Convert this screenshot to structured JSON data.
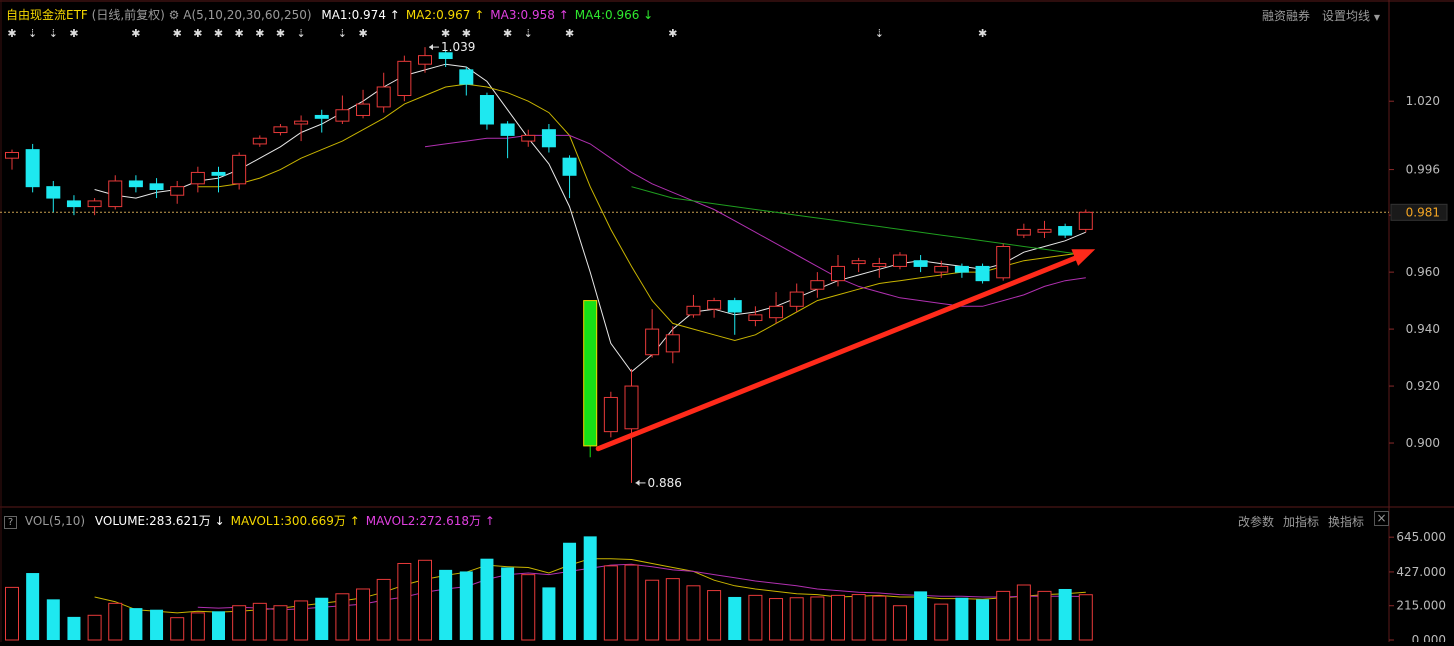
{
  "header": {
    "title": "自由现金流ETF",
    "period": "(日线,前复权)",
    "ma_params": "A(5,10,20,30,60,250)",
    "ma_values": [
      {
        "label": "MA1:0.974",
        "arrow": "↑",
        "color": "#ffffff"
      },
      {
        "label": "MA2:0.967",
        "arrow": "↑",
        "color": "#f5d800"
      },
      {
        "label": "MA3:0.958",
        "arrow": "↑",
        "color": "#e040e0"
      },
      {
        "label": "MA4:0.966",
        "arrow": "↓",
        "color": "#2ee82e"
      }
    ],
    "right_buttons": [
      "融资融券",
      "设置均线"
    ]
  },
  "volume_header": {
    "help": "?",
    "label": "VOL(5,10)",
    "items": [
      {
        "label": "VOLUME:283.621万",
        "arrow": "↓",
        "color": "#ffffff"
      },
      {
        "label": "MAVOL1:300.669万",
        "arrow": "↑",
        "color": "#f5d800"
      },
      {
        "label": "MAVOL2:272.618万",
        "arrow": "↑",
        "color": "#e040e0"
      }
    ],
    "right_buttons": [
      "改参数",
      "加指标",
      "换指标"
    ],
    "close": "×"
  },
  "chart_data": {
    "type": "candlestick",
    "price_axis": {
      "ticks": [
        "1.020",
        "0.996",
        "0.980",
        "0.960",
        "0.940",
        "0.920",
        "0.900"
      ],
      "tick_values": [
        1.02,
        0.996,
        0.98,
        0.96,
        0.94,
        0.92,
        0.9
      ],
      "ylim": [
        0.88,
        1.045
      ]
    },
    "current_price": {
      "label": "0.981",
      "value": 0.981
    },
    "annotations": [
      {
        "label": "1.039",
        "value": 1.039,
        "type": "high"
      },
      {
        "label": "0.886",
        "value": 0.886,
        "type": "low"
      }
    ],
    "candles": [
      [
        1.0,
        1.002,
        1.003,
        0.996
      ],
      [
        1.003,
        0.99,
        1.005,
        0.988
      ],
      [
        0.99,
        0.986,
        0.992,
        0.981
      ],
      [
        0.985,
        0.983,
        0.987,
        0.98
      ],
      [
        0.983,
        0.985,
        0.986,
        0.98
      ],
      [
        0.983,
        0.992,
        0.994,
        0.982
      ],
      [
        0.992,
        0.99,
        0.994,
        0.988
      ],
      [
        0.991,
        0.989,
        0.993,
        0.986
      ],
      [
        0.987,
        0.99,
        0.992,
        0.984
      ],
      [
        0.991,
        0.995,
        0.997,
        0.988
      ],
      [
        0.995,
        0.994,
        0.997,
        0.988
      ],
      [
        0.991,
        1.001,
        1.002,
        0.989
      ],
      [
        1.005,
        1.007,
        1.008,
        1.004
      ],
      [
        1.009,
        1.011,
        1.012,
        1.008
      ],
      [
        1.012,
        1.013,
        1.015,
        1.006
      ],
      [
        1.015,
        1.014,
        1.017,
        1.009
      ],
      [
        1.013,
        1.017,
        1.022,
        1.012
      ],
      [
        1.015,
        1.019,
        1.024,
        1.014
      ],
      [
        1.018,
        1.025,
        1.03,
        1.016
      ],
      [
        1.022,
        1.034,
        1.036,
        1.02
      ],
      [
        1.033,
        1.036,
        1.039,
        1.03
      ],
      [
        1.037,
        1.035,
        1.038,
        1.032
      ],
      [
        1.031,
        1.026,
        1.032,
        1.022
      ],
      [
        1.022,
        1.012,
        1.023,
        1.01
      ],
      [
        1.012,
        1.008,
        1.013,
        1.0
      ],
      [
        1.006,
        1.008,
        1.01,
        1.004
      ],
      [
        1.01,
        1.004,
        1.012,
        1.002
      ],
      [
        1.0,
        0.994,
        1.001,
        0.986
      ],
      [
        0.95,
        0.899,
        0.95,
        0.895
      ],
      [
        0.904,
        0.916,
        0.918,
        0.902
      ],
      [
        0.905,
        0.92,
        0.926,
        0.886
      ],
      [
        0.931,
        0.94,
        0.947,
        0.93
      ],
      [
        0.932,
        0.938,
        0.941,
        0.928
      ],
      [
        0.945,
        0.948,
        0.952,
        0.944
      ],
      [
        0.947,
        0.95,
        0.951,
        0.944
      ],
      [
        0.95,
        0.946,
        0.951,
        0.938
      ],
      [
        0.943,
        0.945,
        0.948,
        0.941
      ],
      [
        0.944,
        0.948,
        0.953,
        0.942
      ],
      [
        0.948,
        0.953,
        0.956,
        0.946
      ],
      [
        0.954,
        0.957,
        0.96,
        0.951
      ],
      [
        0.957,
        0.962,
        0.966,
        0.955
      ],
      [
        0.963,
        0.964,
        0.965,
        0.96
      ],
      [
        0.962,
        0.963,
        0.965,
        0.958
      ],
      [
        0.962,
        0.966,
        0.967,
        0.961
      ],
      [
        0.964,
        0.962,
        0.966,
        0.96
      ],
      [
        0.96,
        0.962,
        0.964,
        0.958
      ],
      [
        0.962,
        0.96,
        0.963,
        0.958
      ],
      [
        0.962,
        0.957,
        0.963,
        0.956
      ],
      [
        0.958,
        0.969,
        0.97,
        0.957
      ],
      [
        0.973,
        0.975,
        0.977,
        0.972
      ],
      [
        0.974,
        0.975,
        0.978,
        0.972
      ],
      [
        0.976,
        0.973,
        0.977,
        0.972
      ],
      [
        0.975,
        0.981,
        0.982,
        0.974
      ]
    ],
    "series": [
      {
        "values": [
          null,
          null,
          null,
          null,
          0.989,
          0.987,
          0.986,
          0.988,
          0.989,
          0.992,
          0.993,
          0.996,
          1.0,
          1.004,
          1.009,
          1.012,
          1.016,
          1.02,
          1.025,
          1.029,
          1.031,
          1.033,
          1.032,
          1.027,
          1.017,
          1.007,
          0.998,
          0.983,
          0.96,
          0.935,
          0.925,
          0.931,
          0.94,
          0.946,
          0.947,
          0.945,
          0.946,
          0.948,
          0.951,
          0.954,
          0.957,
          0.959,
          0.961,
          0.963,
          0.964,
          0.963,
          0.962,
          0.961,
          0.963,
          0.967,
          0.969,
          0.971,
          0.974
        ]
      },
      {
        "values": [
          null,
          null,
          null,
          null,
          null,
          null,
          null,
          null,
          null,
          0.99,
          0.99,
          0.991,
          0.993,
          0.996,
          1.0,
          1.003,
          1.006,
          1.01,
          1.014,
          1.019,
          1.022,
          1.025,
          1.026,
          1.025,
          1.023,
          1.02,
          1.016,
          1.008,
          0.99,
          0.975,
          0.962,
          0.95,
          0.942,
          0.94,
          0.938,
          0.936,
          0.938,
          0.942,
          0.946,
          0.95,
          0.952,
          0.954,
          0.956,
          0.957,
          0.958,
          0.959,
          0.96,
          0.96,
          0.962,
          0.964,
          0.965,
          0.966,
          0.967
        ]
      },
      {
        "values": [
          null,
          null,
          null,
          null,
          null,
          null,
          null,
          null,
          null,
          null,
          null,
          null,
          null,
          null,
          null,
          null,
          null,
          null,
          null,
          null,
          1.004,
          1.005,
          1.006,
          1.007,
          1.007,
          1.008,
          1.008,
          1.008,
          1.005,
          1.0,
          0.995,
          0.991,
          0.988,
          0.985,
          0.982,
          0.978,
          0.974,
          0.97,
          0.966,
          0.962,
          0.958,
          0.955,
          0.953,
          0.951,
          0.95,
          0.949,
          0.948,
          0.948,
          0.95,
          0.952,
          0.955,
          0.957,
          0.958
        ]
      },
      {
        "values": [
          null,
          null,
          null,
          null,
          null,
          null,
          null,
          null,
          null,
          null,
          null,
          null,
          null,
          null,
          null,
          null,
          null,
          null,
          null,
          null,
          null,
          null,
          null,
          null,
          null,
          null,
          null,
          null,
          null,
          null,
          0.99,
          0.988,
          0.986,
          0.985,
          0.984,
          0.983,
          0.982,
          0.981,
          0.98,
          0.979,
          0.978,
          0.977,
          0.976,
          0.975,
          0.974,
          0.973,
          0.972,
          0.971,
          0.97,
          0.969,
          0.968,
          0.967,
          0.966
        ]
      }
    ],
    "marker_columns": [
      0,
      1,
      2,
      3,
      6,
      8,
      9,
      10,
      11,
      12,
      13,
      14,
      16,
      17,
      21,
      22,
      24,
      25,
      27,
      32,
      42,
      47
    ],
    "marker_arrow_columns": [
      1,
      2,
      14,
      16,
      25,
      42
    ],
    "volume_axis": {
      "ticks": [
        "645.000",
        "427.000",
        "215.000",
        "0.000"
      ],
      "tick_values": [
        645,
        427,
        215,
        0
      ],
      "ylim": [
        0,
        690
      ]
    },
    "volume": [
      330,
      420,
      255,
      145,
      155,
      230,
      200,
      190,
      140,
      170,
      180,
      215,
      230,
      215,
      245,
      265,
      290,
      320,
      380,
      480,
      500,
      440,
      430,
      510,
      455,
      410,
      330,
      610,
      650,
      465,
      470,
      375,
      385,
      340,
      310,
      270,
      280,
      260,
      265,
      270,
      280,
      285,
      275,
      215,
      305,
      225,
      265,
      255,
      305,
      345,
      305,
      320,
      284
    ],
    "volume_series": [
      {
        "values": [
          null,
          null,
          null,
          null,
          270,
          240,
          190,
          180,
          170,
          180,
          175,
          180,
          190,
          200,
          215,
          230,
          245,
          265,
          300,
          345,
          380,
          405,
          425,
          470,
          460,
          455,
          420,
          470,
          510,
          510,
          505,
          480,
          455,
          430,
          375,
          340,
          320,
          305,
          290,
          285,
          270,
          275,
          280,
          270,
          270,
          260,
          260,
          255,
          265,
          275,
          285,
          290,
          300
        ]
      },
      {
        "values": [
          null,
          null,
          null,
          null,
          null,
          null,
          null,
          null,
          null,
          205,
          200,
          205,
          200,
          190,
          195,
          205,
          215,
          225,
          250,
          270,
          300,
          320,
          335,
          380,
          410,
          420,
          410,
          430,
          450,
          470,
          475,
          460,
          440,
          430,
          410,
          390,
          370,
          355,
          340,
          320,
          310,
          300,
          295,
          285,
          280,
          275,
          275,
          270,
          270,
          275,
          275,
          275,
          273
        ]
      }
    ]
  }
}
